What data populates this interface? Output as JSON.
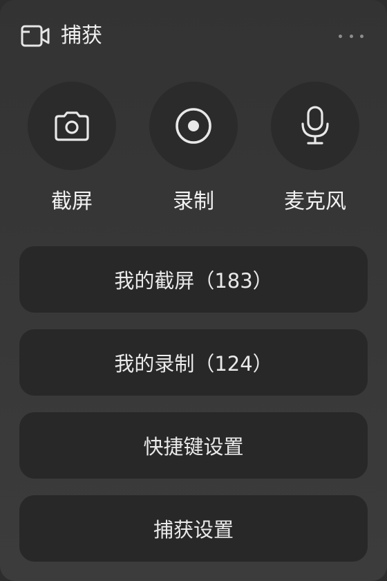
{
  "header": {
    "title": "捕获",
    "icon": "video-camera-icon",
    "more_icon": "more-icon"
  },
  "actions": [
    {
      "label": "截屏",
      "icon": "camera-icon"
    },
    {
      "label": "录制",
      "icon": "record-icon"
    },
    {
      "label": "麦克风",
      "icon": "microphone-icon"
    }
  ],
  "menu": [
    {
      "label": "我的截屏（183）"
    },
    {
      "label": "我的录制（124）"
    },
    {
      "label": "快捷键设置"
    },
    {
      "label": "捕获设置"
    }
  ],
  "colors": {
    "panel_bg": "#363636",
    "button_bg": "#282828",
    "text": "#f0f0f0",
    "muted": "#8d8d8d"
  }
}
